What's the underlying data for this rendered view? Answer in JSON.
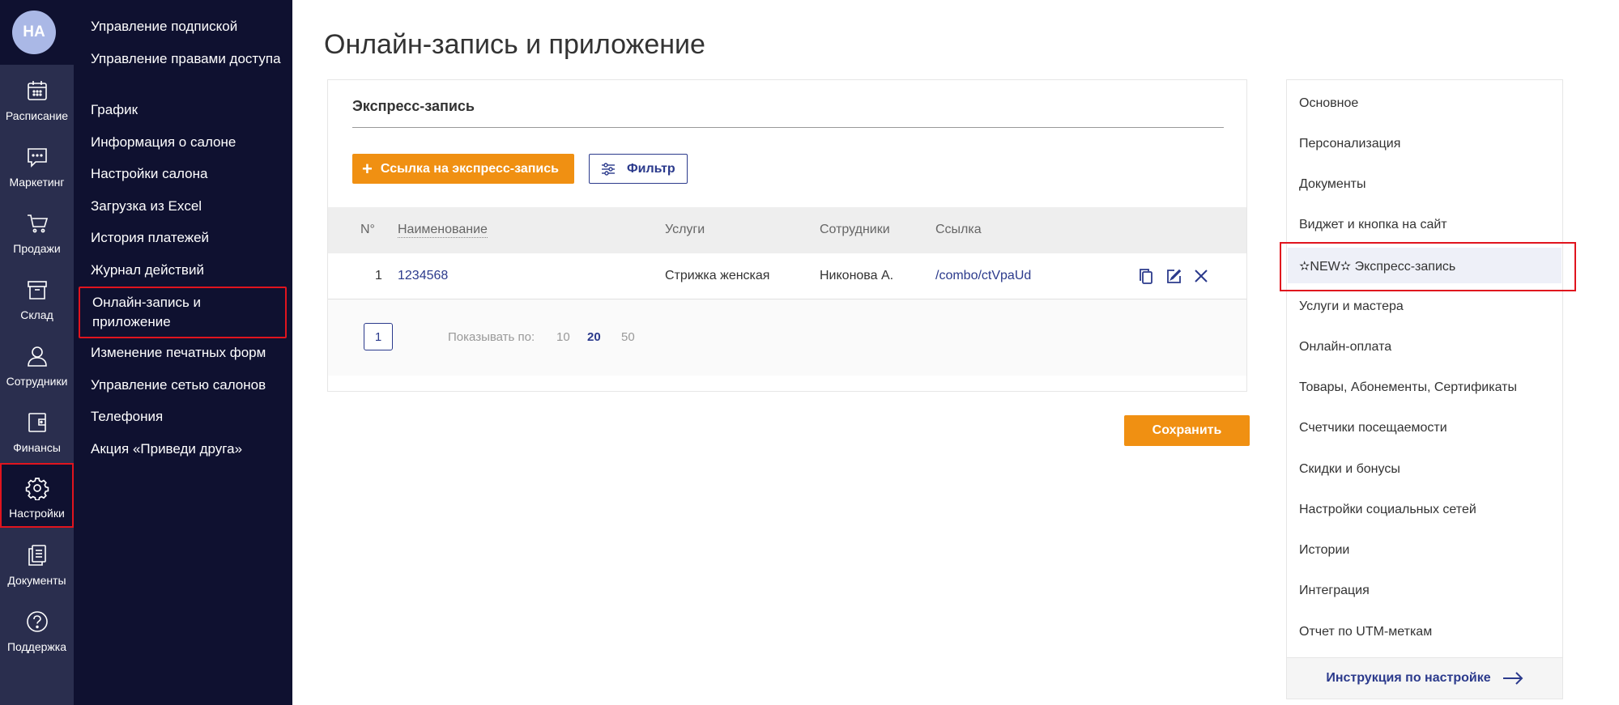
{
  "user": {
    "initials": "НА"
  },
  "rail": {
    "items": [
      {
        "label": "Расписание",
        "icon": "calendar-icon"
      },
      {
        "label": "Маркетинг",
        "icon": "chat-icon"
      },
      {
        "label": "Продажи",
        "icon": "cart-icon"
      },
      {
        "label": "Склад",
        "icon": "box-icon"
      },
      {
        "label": "Сотрудники",
        "icon": "person-icon"
      },
      {
        "label": "Финансы",
        "icon": "wallet-icon"
      },
      {
        "label": "Настройки",
        "icon": "gear-icon",
        "active": true
      },
      {
        "label": "Документы",
        "icon": "documents-icon"
      },
      {
        "label": "Поддержка",
        "icon": "help-icon"
      }
    ]
  },
  "submenu": {
    "items": [
      "Управление подпиской",
      "Управление правами доступа",
      "График",
      "Информация о салоне",
      "Настройки салона",
      "Загрузка из Excel",
      "История платежей",
      "Журнал действий",
      "Онлайн-запись и приложение",
      "Изменение печатных форм",
      "Управление сетью салонов",
      "Телефония",
      "Акция «Приведи друга»"
    ],
    "active_index": 8
  },
  "main": {
    "title": "Онлайн-запись и приложение",
    "section_title": "Экспресс-запись",
    "add_button": "Ссылка на экспресс-запись",
    "filter_button": "Фильтр",
    "table": {
      "headers": [
        "N°",
        "Наименование",
        "Услуги",
        "Сотрудники",
        "Ссылка"
      ],
      "rows": [
        {
          "num": "1",
          "name": "1234568",
          "service": "Стрижка женская",
          "staff": "Никонова А.",
          "link": "/combo/ctVpaUd"
        }
      ]
    },
    "pagination": {
      "current_page": "1",
      "show_label": "Показывать по:",
      "options": [
        "10",
        "20",
        "50"
      ],
      "selected": "20"
    },
    "save_button": "Сохранить"
  },
  "settings_menu": {
    "items": [
      "Основное",
      "Персонализация",
      "Документы",
      "Виджет и кнопка на сайт",
      "✫NEW✫ Экспресс-запись",
      "Услуги и мастера",
      "Онлайн-оплата",
      "Товары, Абонементы, Сертификаты",
      "Счетчики посещаемости",
      "Скидки и бонусы",
      "Настройки социальных сетей",
      "Истории",
      "Интеграция",
      "Отчет по UTM-меткам"
    ],
    "active_index": 4,
    "footer_link": "Инструкция по настройке"
  },
  "colors": {
    "rail_bg": "#2a2e4e",
    "submenu_bg": "#0f1130",
    "accent_orange": "#f09012",
    "link_blue": "#2b3a8c",
    "highlight_red": "#e0141e"
  }
}
